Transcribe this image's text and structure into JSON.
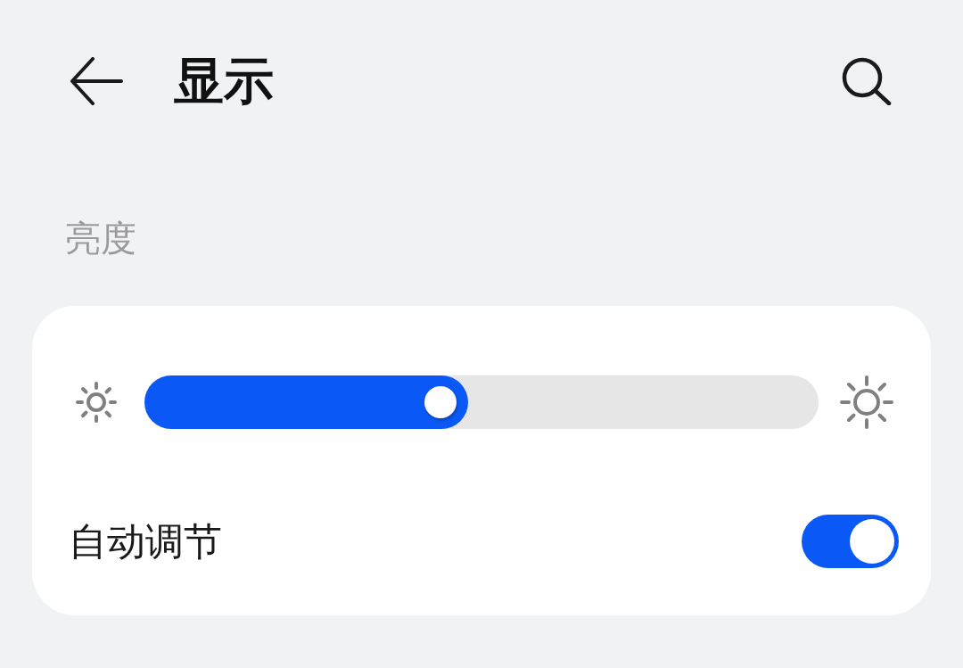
{
  "header": {
    "title": "显示"
  },
  "section": {
    "label": "亮度"
  },
  "brightness": {
    "level": 0.48
  },
  "auto_adjust": {
    "label": "自动调节",
    "on": true
  }
}
